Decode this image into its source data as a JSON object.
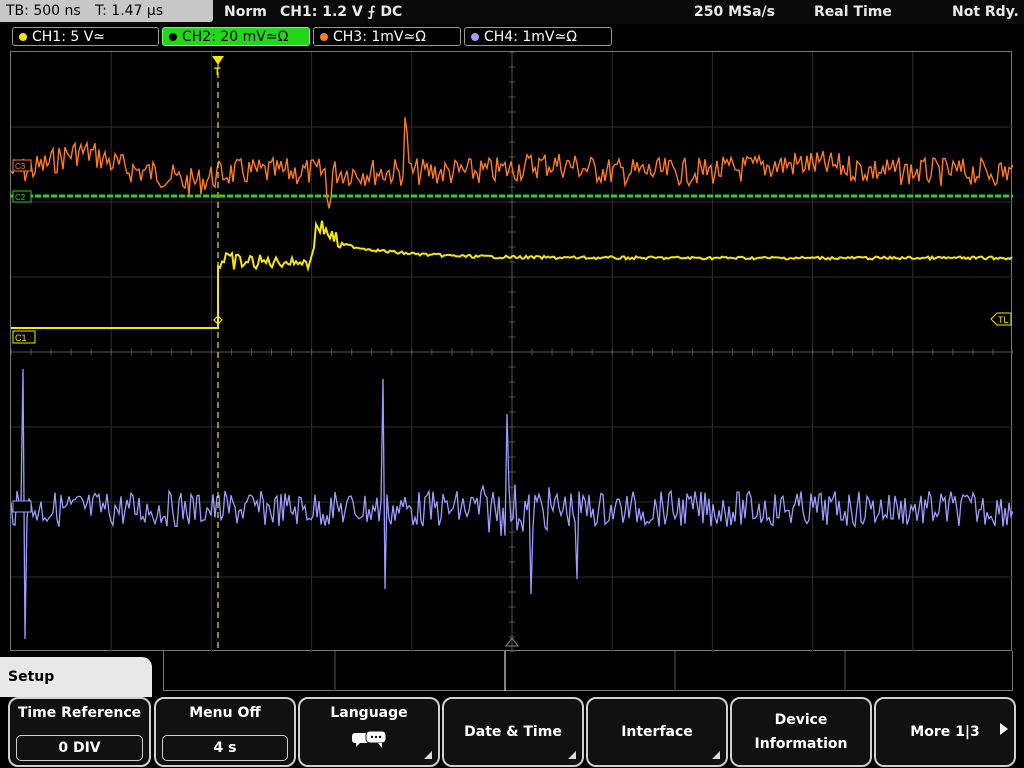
{
  "top": {
    "timebase": "TB: 500 ns",
    "trigger_time": "T: 1.47 µs",
    "mode": "Norm",
    "trigger": "CH1: 1.2 V ⨍ DC",
    "sample_rate": "250 MSa/s",
    "acq": "Real Time",
    "status": "Not Rdy."
  },
  "channels": [
    {
      "label": "CH1: 5 V≃",
      "color": "#f5e60a"
    },
    {
      "label": "CH2: 20 mV≃Ω",
      "color": "#22d61a"
    },
    {
      "label": "CH3: 1mV≃Ω",
      "color": "#ff7a22"
    },
    {
      "label": "CH4: 1mV≃Ω",
      "color": "#9c9cff"
    }
  ],
  "markers": {
    "c1": "C1",
    "c2": "C2",
    "c3": "C3",
    "trigger_level": "TL",
    "trigger_pos": "T"
  },
  "softkeys": {
    "menu_title": "Setup",
    "time_reference": {
      "label": "Time Reference",
      "value": "0 DIV"
    },
    "menu_off": {
      "label": "Menu Off",
      "value": "4 s"
    },
    "language": {
      "label": "Language",
      "icon": "speech-bubbles-icon"
    },
    "date_time": {
      "label": "Date & Time"
    },
    "interface": {
      "label": "Interface"
    },
    "device_info": {
      "label1": "Device",
      "label2": "Information"
    },
    "more": {
      "label": "More 1|3"
    }
  }
}
